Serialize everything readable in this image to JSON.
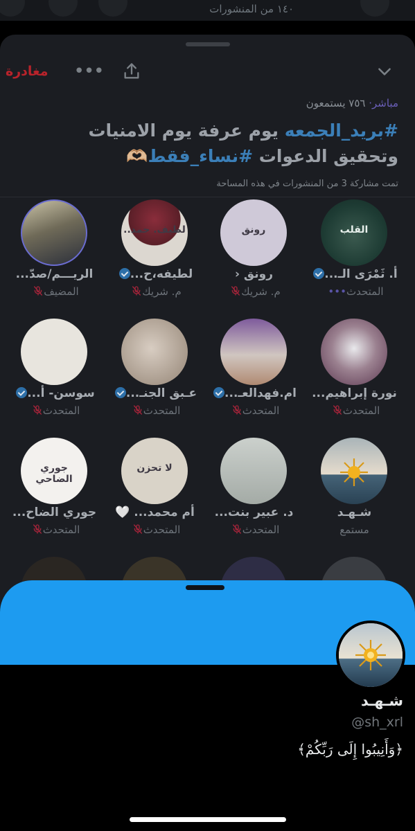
{
  "feed": {
    "post_count": "١٤٠ من المنشورات"
  },
  "room": {
    "leave_label": "مغادرة",
    "more_icon": "more-icon",
    "share_icon": "share-icon",
    "collapse_icon": "chevron-down-icon",
    "live_label": "مباشر·",
    "listeners": "٧٥٦ يستمعون",
    "title_tag1": "#بريد_الجمعه",
    "title_mid": " يوم عرفة يوم الامنيات وتحقيق الدعوات ",
    "title_tag2": "#نساء_فقط",
    "title_emoji": "🫶🏼",
    "note": "تمت مشاركة 3 من المنشورات في هذه المساحة",
    "participants": [
      {
        "name": "أ. ثَمْرَى الـ...",
        "role": "المتحدث",
        "verified": true,
        "speaking": true,
        "avatar_text": "القلب"
      },
      {
        "name": "رونق ‹",
        "role": "م. شريك",
        "verified": false,
        "speaking": false,
        "avatar_text": "رونق"
      },
      {
        "name": "لطيفه،ح...",
        "role": "م. شريك",
        "verified": true,
        "speaking": false,
        "avatar_text": "لطيف. حمد.."
      },
      {
        "name": "الريـــم/صدّ...",
        "role": "المضيف",
        "verified": false,
        "speaking": false,
        "avatar_text": ""
      },
      {
        "name": "نورة إبراهيم...",
        "role": "المتحدث",
        "verified": false,
        "speaking": false,
        "avatar_text": ""
      },
      {
        "name": "ام.فهدالعـ...",
        "role": "المتحدث",
        "verified": true,
        "speaking": false,
        "avatar_text": ""
      },
      {
        "name": "عـبق الجنـ...",
        "role": "المتحدث",
        "verified": true,
        "speaking": false,
        "avatar_text": ""
      },
      {
        "name": "سوسن- أ...",
        "role": "المتحدث",
        "verified": true,
        "speaking": false,
        "avatar_text": ""
      },
      {
        "name": "شـهـد",
        "role": "مستمع",
        "verified": false,
        "speaking": false,
        "avatar_text": ""
      },
      {
        "name": "د. عبير بنت...",
        "role": "المتحدث",
        "verified": false,
        "speaking": false,
        "avatar_text": ""
      },
      {
        "name": "أم محمد... 🤍",
        "role": "المتحدث",
        "verified": false,
        "speaking": false,
        "avatar_text": "لا تحزن"
      },
      {
        "name": "جوري الضاح...",
        "role": "المتحدث",
        "verified": false,
        "speaking": false,
        "avatar_text": "جوري الضاحي"
      }
    ]
  },
  "profile": {
    "name": "شـهـد",
    "handle": "@sh_xrl",
    "bio": "﴿وَأَنِيبُوا إِلَى رَبِّكُمْ﴾"
  }
}
